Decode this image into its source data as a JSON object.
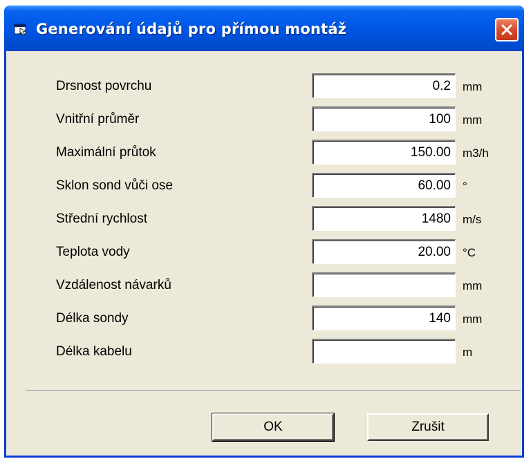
{
  "window": {
    "title": "Generování údajů pro přímou montáž"
  },
  "fields": [
    {
      "label": "Drsnost povrchu",
      "value": "0.2",
      "unit": "mm"
    },
    {
      "label": "Vnitřní průměr",
      "value": "100",
      "unit": "mm"
    },
    {
      "label": "Maximální průtok",
      "value": "150.00",
      "unit": "m3/h"
    },
    {
      "label": "Sklon sond vůči ose",
      "value": "60.00",
      "unit": "°"
    },
    {
      "label": "Střední rychlost",
      "value": "1480",
      "unit": "m/s"
    },
    {
      "label": "Teplota vody",
      "value": "20.00",
      "unit": "°C"
    },
    {
      "label": "Vzdálenost návarků",
      "value": "",
      "unit": "mm"
    },
    {
      "label": "Délka sondy",
      "value": "140",
      "unit": "mm"
    },
    {
      "label": "Délka kabelu",
      "value": "",
      "unit": "m"
    }
  ],
  "buttons": {
    "ok_label": "OK",
    "cancel_label": "Zrušit"
  },
  "icons": {
    "window": "window-app-icon",
    "close": "close-icon"
  },
  "colors": {
    "titlebar": "#0058e6",
    "dialog_background": "#ece9d8",
    "close_button": "#d84b2c"
  }
}
